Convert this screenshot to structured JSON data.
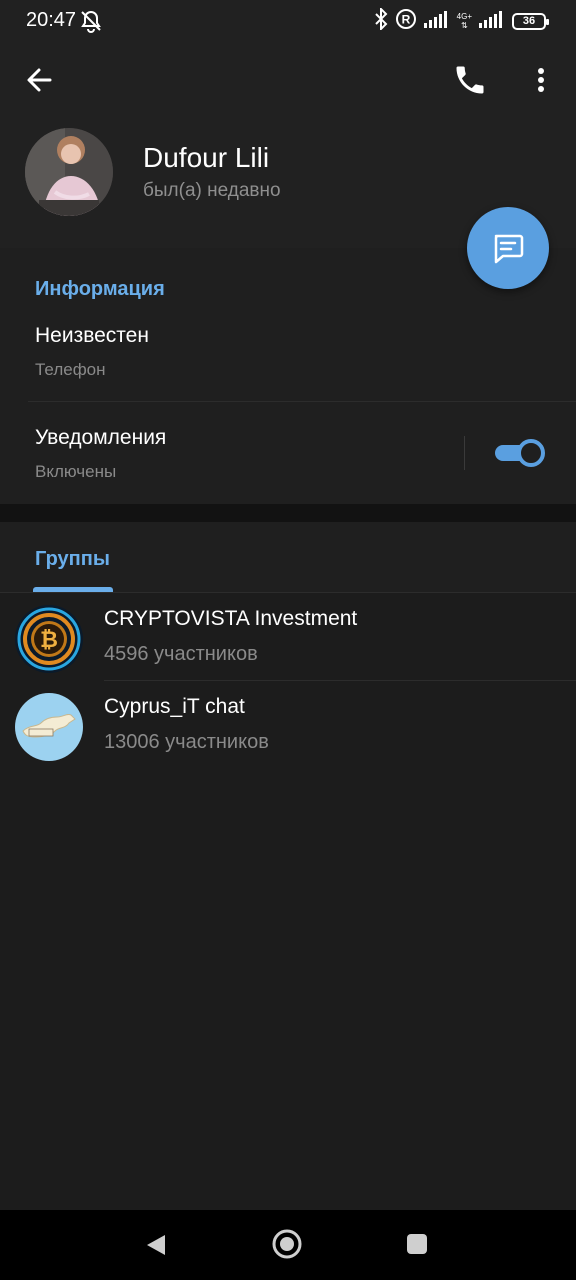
{
  "status_bar": {
    "time": "20:47",
    "network_label": "4G+",
    "battery": "36",
    "icons": [
      "bell-off-icon",
      "bluetooth-icon",
      "registered-icon",
      "signal-icon",
      "battery-icon"
    ]
  },
  "header": {
    "name": "Dufour Lili",
    "status": "был(а) недавно",
    "actions": [
      "back-arrow-icon",
      "phone-icon",
      "more-vert-icon"
    ]
  },
  "info": {
    "section_title": "Информация",
    "phone_value": "Неизвестен",
    "phone_label": "Телефон",
    "notifications_title": "Уведомления",
    "notifications_state": "Включены",
    "notifications_enabled": true
  },
  "groups": {
    "tab_label": "Группы",
    "items": [
      {
        "name": "CRYPTOVISTA Investment",
        "members": "4596 участников"
      },
      {
        "name": "Cyprus_iT chat",
        "members": "13006 участников"
      }
    ]
  },
  "colors": {
    "accent": "#5a9fe0",
    "section_text": "#6aaeea",
    "background": "#1a1a1a",
    "header_bg": "#212121"
  },
  "nav": {
    "icons": [
      "nav-back-icon",
      "nav-home-icon",
      "nav-recents-icon"
    ]
  }
}
